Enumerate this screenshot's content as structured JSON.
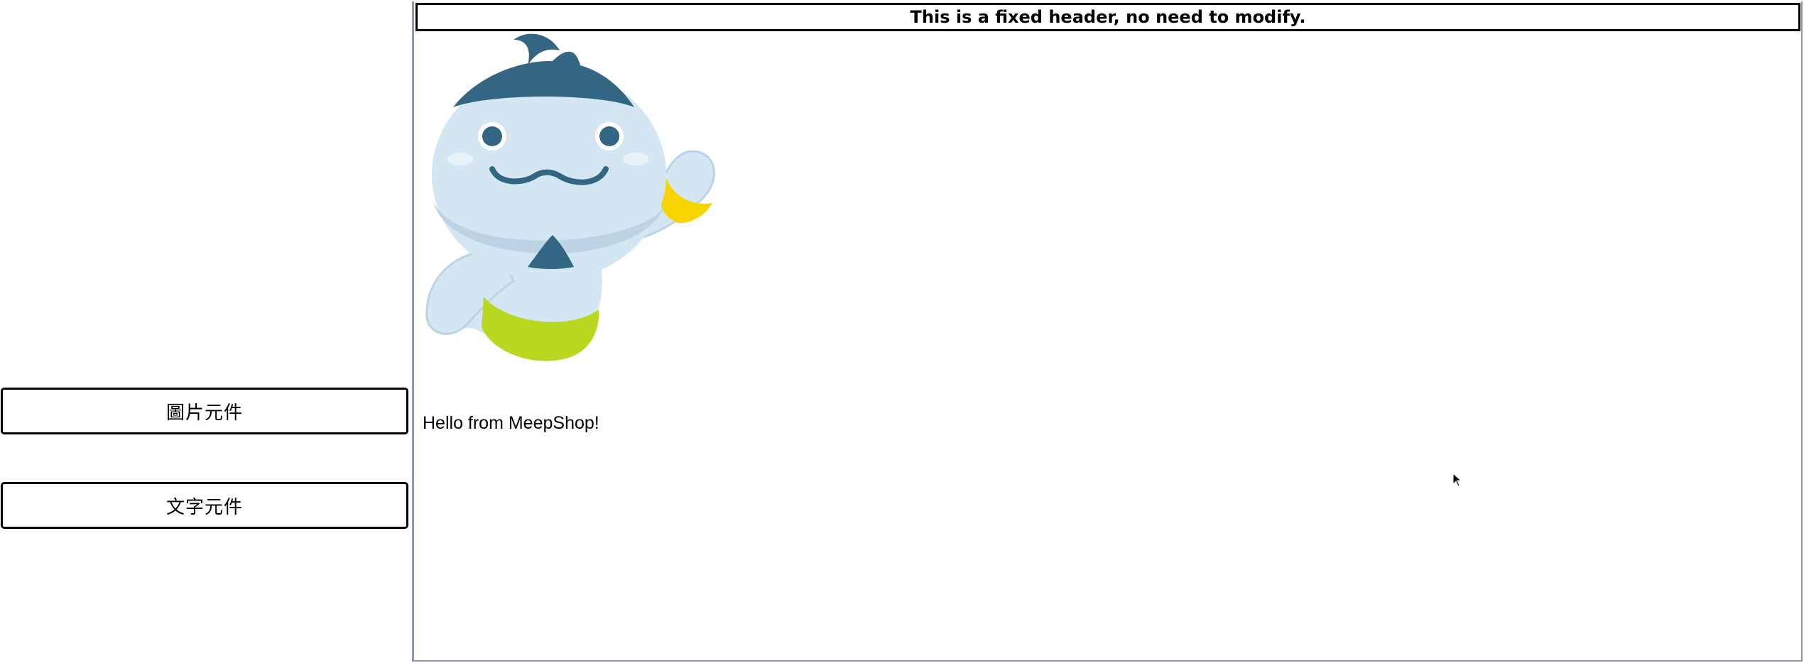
{
  "sidebar": {
    "items": [
      {
        "label": "圖片元件"
      },
      {
        "label": "文字元件"
      }
    ]
  },
  "canvas": {
    "header_text": "This is a fixed header, no need to modify.",
    "image_icon": "genie-mascot-image",
    "text_content": "Hello from MeepShop!"
  },
  "colors": {
    "border_dark": "#000000",
    "canvas_border": "#8e9aaf",
    "mascot_body": "#d3e6f2",
    "mascot_dark": "#336682",
    "mascot_belt": "#b8d820",
    "mascot_bracelet": "#f5d400"
  },
  "cursor_icon": "mouse-pointer-icon"
}
